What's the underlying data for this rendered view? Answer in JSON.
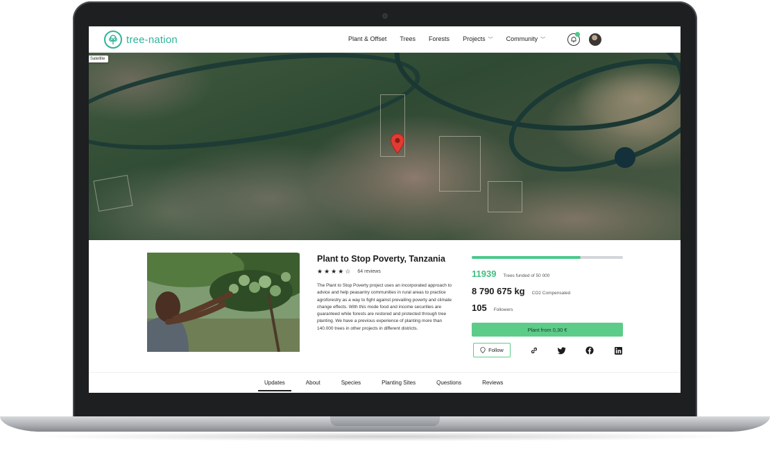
{
  "navbar": {
    "logo_text": "tree-nation",
    "links": [
      "Plant & Offset",
      "Trees",
      "Forests",
      "Projects",
      "Community"
    ],
    "brand_color": "#2fb39a"
  },
  "map": {
    "layer_button": "Satellite"
  },
  "project": {
    "title": "Plant to Stop Poverty, Tanzania",
    "rating": 4,
    "rating_max": 5,
    "reviews": "64 reviews",
    "description": "The Plant to Stop Poverty project uses an incorporated approach to advice and help peasantry communities in rural areas to practice agroforestry as a way to fight against prevailing poverty and climate change effects. With this mode food and income securities are guaranteed while forests are restored and protected through tree planting. We have a previous experience of planting more than 140.000 trees in other projects in different districts."
  },
  "stats": {
    "progress_fraction": 0.72,
    "trees_value": "11939",
    "trees_label": "Trees funded of 50 000",
    "co2_value": "8 790 675 kg",
    "co2_label": "CO2 Compensated",
    "followers_value": "105",
    "followers_label": "Followers",
    "plant_button": "Plant from 0,30 €",
    "follow_button": "Follow",
    "accent_color": "#5ccc88"
  },
  "tabs": [
    "Updates",
    "About",
    "Species",
    "Planting Sites",
    "Questions",
    "Reviews"
  ],
  "active_tab": "Updates"
}
